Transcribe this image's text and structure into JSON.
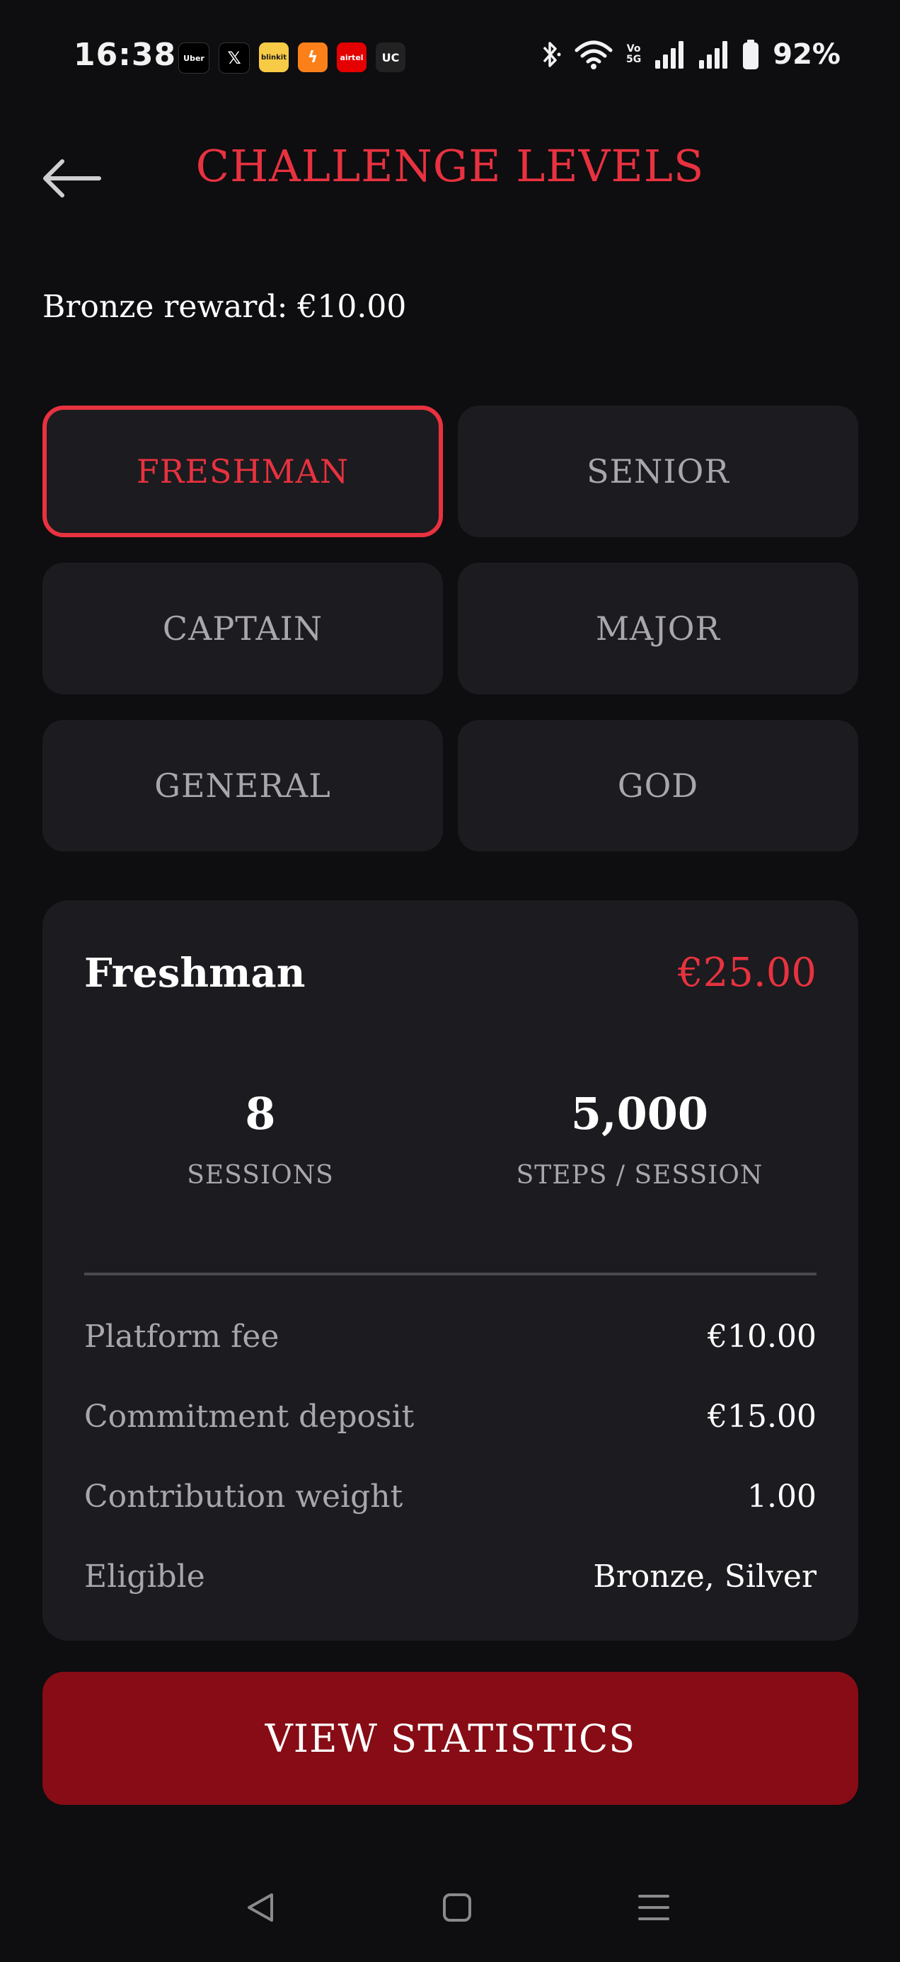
{
  "status_bar": {
    "time": "16:38",
    "notifications": [
      "Uber",
      "𝕏",
      "blinkit",
      "ϟ",
      "airtel",
      "UC"
    ],
    "volte_top": "Vo",
    "volte_bottom": "5G",
    "battery": "92%"
  },
  "header": {
    "title": "CHALLENGE LEVELS"
  },
  "reward": {
    "text": "Bronze reward: €10.00"
  },
  "levels": [
    {
      "label": "FRESHMAN",
      "active": true
    },
    {
      "label": "SENIOR",
      "active": false
    },
    {
      "label": "CAPTAIN",
      "active": false
    },
    {
      "label": "MAJOR",
      "active": false
    },
    {
      "label": "GENERAL",
      "active": false
    },
    {
      "label": "GOD",
      "active": false
    }
  ],
  "detail": {
    "name": "Freshman",
    "price": "€25.00",
    "sessions_value": "8",
    "sessions_label": "SESSIONS",
    "steps_value": "5,000",
    "steps_label": "STEPS / SESSION",
    "rows": [
      {
        "label": "Platform fee",
        "value": "€10.00"
      },
      {
        "label": "Commitment deposit",
        "value": "€15.00"
      },
      {
        "label": "Contribution weight",
        "value": "1.00"
      },
      {
        "label": "Eligible",
        "value": "Bronze, Silver"
      }
    ]
  },
  "actions": {
    "view_statistics": "VIEW STATISTICS"
  },
  "colors": {
    "background": "#0e0d10",
    "card": "#1c1b1f",
    "accent": "#e8323f",
    "button": "#870c15",
    "muted_text": "#a9a7ac"
  },
  "icons": {
    "back": "arrow-left-icon",
    "bluetooth": "bluetooth-icon",
    "wifi": "wifi-icon",
    "signal": "signal-icon",
    "battery": "battery-icon",
    "nav_back": "triangle-back-icon",
    "nav_home": "square-home-icon",
    "nav_menu": "menu-lines-icon"
  }
}
